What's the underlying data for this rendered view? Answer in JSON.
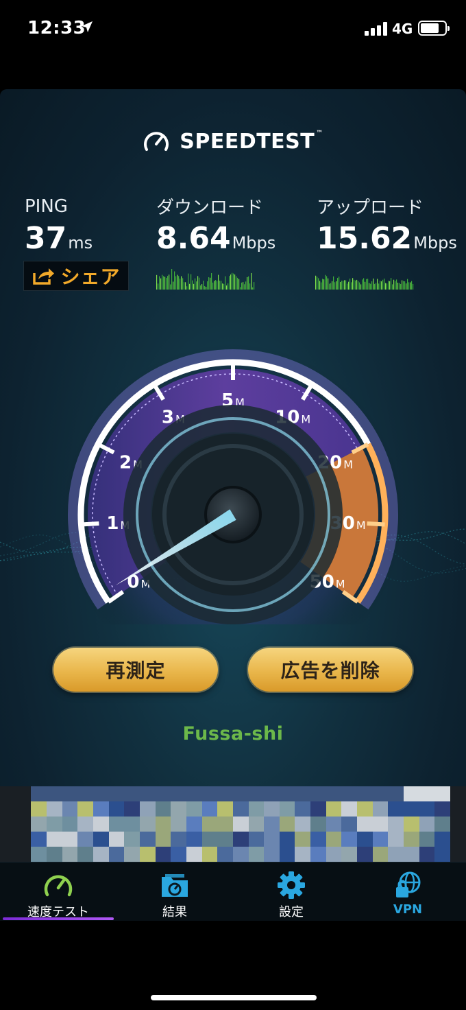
{
  "status": {
    "time": "12:33",
    "network": "4G"
  },
  "app": {
    "title": "SPEEDTEST",
    "trademark": "™",
    "ping": {
      "label": "PING",
      "value": "37",
      "unit": "ms"
    },
    "download": {
      "label": "ダウンロード",
      "value": "8.64",
      "unit": "Mbps"
    },
    "upload": {
      "label": "アップロード",
      "value": "15.62",
      "unit": "Mbps"
    },
    "share_label": "シェア",
    "gauge": {
      "ticks": [
        {
          "num": "0",
          "unit": "M"
        },
        {
          "num": "1",
          "unit": "M"
        },
        {
          "num": "2",
          "unit": "M"
        },
        {
          "num": "3",
          "unit": "M"
        },
        {
          "num": "5",
          "unit": "M"
        },
        {
          "num": "10",
          "unit": "M"
        },
        {
          "num": "20",
          "unit": "M"
        },
        {
          "num": "30",
          "unit": "M"
        },
        {
          "num": "50",
          "unit": "M"
        }
      ]
    },
    "retest_label": "再測定",
    "remove_ads_label": "広告を削除",
    "location": "Fussa-shi"
  },
  "tabs": [
    {
      "label": "速度テスト",
      "icon": "speedometer-icon",
      "active": true
    },
    {
      "label": "結果",
      "icon": "results-folder-icon",
      "active": false
    },
    {
      "label": "設定",
      "icon": "gear-icon",
      "active": false
    },
    {
      "label": "VPN",
      "icon": "vpn-lock-globe-icon",
      "active": false
    }
  ],
  "colors": {
    "accent_orange": "#f2a92a",
    "location_green": "#6cb84a",
    "tab_active_green": "#8fd14f",
    "tab_icon_blue": "#2aa7e0",
    "gauge_purple": "#5a3d9a",
    "gauge_orange": "#d98a3c",
    "button_gold": "#e9b64b"
  }
}
